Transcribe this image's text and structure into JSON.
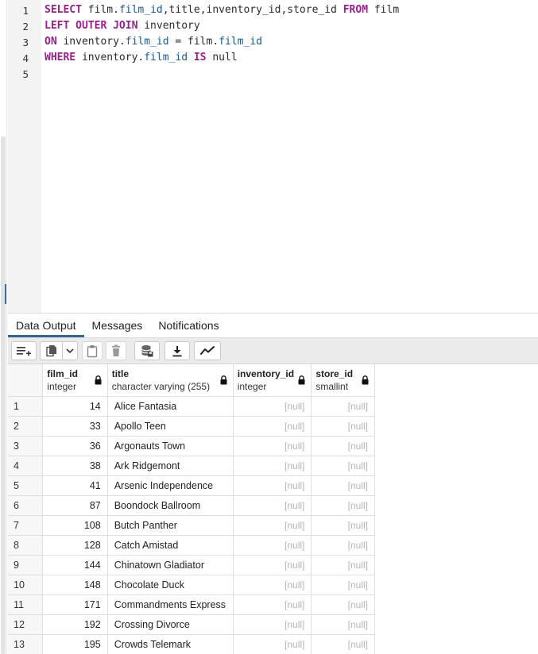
{
  "editor": {
    "lines": [
      {
        "num": "1",
        "segments": [
          {
            "t": "SELECT",
            "c": "kw"
          },
          {
            "t": " film.",
            "c": ""
          },
          {
            "t": "film_id",
            "c": "fld"
          },
          {
            "t": ",title,inventory_id,store_id ",
            "c": ""
          },
          {
            "t": "FROM",
            "c": "kw"
          },
          {
            "t": " film",
            "c": ""
          }
        ]
      },
      {
        "num": "2",
        "segments": [
          {
            "t": "LEFT OUTER JOIN",
            "c": "kw"
          },
          {
            "t": " inventory",
            "c": ""
          }
        ]
      },
      {
        "num": "3",
        "segments": [
          {
            "t": "ON",
            "c": "kw"
          },
          {
            "t": " inventory.",
            "c": ""
          },
          {
            "t": "film_id",
            "c": "fld"
          },
          {
            "t": " = film.",
            "c": ""
          },
          {
            "t": "film_id",
            "c": "fld"
          }
        ]
      },
      {
        "num": "4",
        "segments": [
          {
            "t": "WHERE",
            "c": "kw"
          },
          {
            "t": " inventory.",
            "c": ""
          },
          {
            "t": "film_id",
            "c": "fld"
          },
          {
            "t": " ",
            "c": ""
          },
          {
            "t": "IS",
            "c": "kw"
          },
          {
            "t": " null",
            "c": ""
          }
        ]
      },
      {
        "num": "5",
        "segments": []
      }
    ]
  },
  "tabs": [
    {
      "label": "Data Output",
      "active": true
    },
    {
      "label": "Messages",
      "active": false
    },
    {
      "label": "Notifications",
      "active": false
    }
  ],
  "toolbar": {
    "icons": [
      "add-row-icon",
      "copy-icon",
      "chevron-down-icon",
      "paste-icon",
      "delete-icon",
      "save-data-icon",
      "download-icon",
      "graph-icon"
    ]
  },
  "grid": {
    "columns": [
      {
        "name": "film_id",
        "type": "integer"
      },
      {
        "name": "title",
        "type": "character varying (255)"
      },
      {
        "name": "inventory_id",
        "type": "integer"
      },
      {
        "name": "store_id",
        "type": "smallint"
      }
    ],
    "null_text": "[null]",
    "rows": [
      {
        "n": "1",
        "film_id": "14",
        "title": "Alice Fantasia"
      },
      {
        "n": "2",
        "film_id": "33",
        "title": "Apollo Teen"
      },
      {
        "n": "3",
        "film_id": "36",
        "title": "Argonauts Town"
      },
      {
        "n": "4",
        "film_id": "38",
        "title": "Ark Ridgemont"
      },
      {
        "n": "5",
        "film_id": "41",
        "title": "Arsenic Independence"
      },
      {
        "n": "6",
        "film_id": "87",
        "title": "Boondock Ballroom"
      },
      {
        "n": "7",
        "film_id": "108",
        "title": "Butch Panther"
      },
      {
        "n": "8",
        "film_id": "128",
        "title": "Catch Amistad"
      },
      {
        "n": "9",
        "film_id": "144",
        "title": "Chinatown Gladiator"
      },
      {
        "n": "10",
        "film_id": "148",
        "title": "Chocolate Duck"
      },
      {
        "n": "11",
        "film_id": "171",
        "title": "Commandments Express"
      },
      {
        "n": "12",
        "film_id": "192",
        "title": "Crossing Divorce"
      },
      {
        "n": "13",
        "film_id": "195",
        "title": "Crowds Telemark"
      }
    ]
  },
  "colors": {
    "keyword": "#9b1e8c",
    "field": "#1a5a8f",
    "active_tab": "#326690",
    "null_text": "#b5b5b5"
  }
}
